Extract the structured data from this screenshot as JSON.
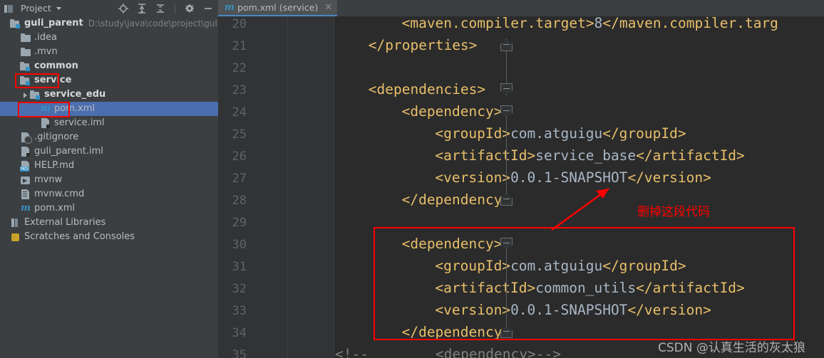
{
  "sidebar": {
    "header": {
      "title": "Project",
      "dropdown_icon": "chevron-down-icon",
      "toolbar": [
        {
          "name": "locate-icon",
          "tooltip": "Select Opened File"
        },
        {
          "name": "expand-all-icon",
          "tooltip": "Expand All"
        },
        {
          "name": "collapse-all-icon",
          "tooltip": "Collapse All"
        },
        {
          "name": "gear-icon",
          "tooltip": "Settings"
        },
        {
          "name": "minimize-icon",
          "tooltip": "Hide"
        }
      ]
    },
    "tree": [
      {
        "label": "guli_parent",
        "path": "D:\\study\\java\\code\\project\\guli_parent",
        "icon": "module-icon",
        "indent": 0,
        "bold": true,
        "arrow": "none",
        "selected": false
      },
      {
        "label": ".idea",
        "path": "",
        "icon": "folder-icon",
        "indent": 1,
        "bold": false,
        "arrow": "none",
        "selected": false
      },
      {
        "label": ".mvn",
        "path": "",
        "icon": "folder-icon",
        "indent": 1,
        "bold": false,
        "arrow": "none",
        "selected": false
      },
      {
        "label": "common",
        "path": "",
        "icon": "module-icon",
        "indent": 1,
        "bold": true,
        "arrow": "none",
        "selected": false
      },
      {
        "label": "service",
        "path": "",
        "icon": "module-icon",
        "indent": 1,
        "bold": true,
        "arrow": "none",
        "selected": false
      },
      {
        "label": "service_edu",
        "path": "",
        "icon": "module-icon",
        "indent": 2,
        "bold": true,
        "arrow": "closed",
        "selected": false
      },
      {
        "label": "pom.xml",
        "path": "",
        "icon": "maven-icon",
        "indent": 3,
        "bold": false,
        "arrow": "none",
        "selected": true
      },
      {
        "label": "service.iml",
        "path": "",
        "icon": "iml-file-icon",
        "indent": 3,
        "bold": false,
        "arrow": "none",
        "selected": false
      },
      {
        "label": ".gitignore",
        "path": "",
        "icon": "gitignore-file-icon",
        "indent": 1,
        "bold": false,
        "arrow": "none",
        "selected": false
      },
      {
        "label": "guli_parent.iml",
        "path": "",
        "icon": "iml-file-icon",
        "indent": 1,
        "bold": false,
        "arrow": "none",
        "selected": false
      },
      {
        "label": "HELP.md",
        "path": "",
        "icon": "markdown-file-icon",
        "indent": 1,
        "bold": false,
        "arrow": "none",
        "selected": false
      },
      {
        "label": "mvnw",
        "path": "",
        "icon": "shell-script-icon",
        "indent": 1,
        "bold": false,
        "arrow": "none",
        "selected": false
      },
      {
        "label": "mvnw.cmd",
        "path": "",
        "icon": "cmd-file-icon",
        "indent": 1,
        "bold": false,
        "arrow": "none",
        "selected": false
      },
      {
        "label": "pom.xml",
        "path": "",
        "icon": "maven-icon",
        "indent": 1,
        "bold": false,
        "arrow": "none",
        "selected": false
      },
      {
        "label": "External Libraries",
        "path": "",
        "icon": "libraries-icon",
        "indent": 0,
        "bold": false,
        "arrow": "none",
        "selected": false
      },
      {
        "label": "Scratches and Consoles",
        "path": "",
        "icon": "scratches-icon",
        "indent": 0,
        "bold": false,
        "arrow": "none",
        "selected": false
      }
    ]
  },
  "editor": {
    "tab": {
      "label": "pom.xml (service)",
      "icon": "maven-icon",
      "close_icon": "close-icon"
    },
    "lines": [
      {
        "num": "20",
        "indent": 8,
        "segments": [
          {
            "t": "tag",
            "s": "<maven.compiler.target>"
          },
          {
            "t": "val",
            "s": "8"
          },
          {
            "t": "tag",
            "s": "</maven.compiler.targ"
          }
        ]
      },
      {
        "num": "21",
        "indent": 4,
        "segments": [
          {
            "t": "tag",
            "s": "</properties>"
          }
        ]
      },
      {
        "num": "22",
        "indent": 0,
        "segments": []
      },
      {
        "num": "23",
        "indent": 4,
        "segments": [
          {
            "t": "tag",
            "s": "<dependencies>"
          }
        ]
      },
      {
        "num": "24",
        "indent": 8,
        "segments": [
          {
            "t": "tag",
            "s": "<dependency>"
          }
        ]
      },
      {
        "num": "25",
        "indent": 12,
        "segments": [
          {
            "t": "tag",
            "s": "<groupId>"
          },
          {
            "t": "val",
            "s": "com.atguigu"
          },
          {
            "t": "tag",
            "s": "</groupId>"
          }
        ]
      },
      {
        "num": "26",
        "indent": 12,
        "segments": [
          {
            "t": "tag",
            "s": "<artifactId>"
          },
          {
            "t": "val",
            "s": "service_base"
          },
          {
            "t": "tag",
            "s": "</artifactId>"
          }
        ]
      },
      {
        "num": "27",
        "indent": 12,
        "segments": [
          {
            "t": "tag",
            "s": "<version>"
          },
          {
            "t": "val",
            "s": "0.0.1-SNAPSHOT"
          },
          {
            "t": "tag",
            "s": "</version>"
          }
        ]
      },
      {
        "num": "28",
        "indent": 8,
        "segments": [
          {
            "t": "tag",
            "s": "</dependency>"
          }
        ]
      },
      {
        "num": "29",
        "indent": 0,
        "segments": []
      },
      {
        "num": "30",
        "indent": 8,
        "segments": [
          {
            "t": "tag",
            "s": "<dependency>"
          }
        ]
      },
      {
        "num": "31",
        "indent": 12,
        "segments": [
          {
            "t": "tag",
            "s": "<groupId>"
          },
          {
            "t": "val",
            "s": "com.atguigu"
          },
          {
            "t": "tag",
            "s": "</groupId>"
          }
        ]
      },
      {
        "num": "32",
        "indent": 12,
        "segments": [
          {
            "t": "tag",
            "s": "<artifactId>"
          },
          {
            "t": "val",
            "s": "common_utils"
          },
          {
            "t": "tag",
            "s": "</artifactId>"
          }
        ]
      },
      {
        "num": "33",
        "indent": 12,
        "segments": [
          {
            "t": "tag",
            "s": "<version>"
          },
          {
            "t": "val",
            "s": "0.0.1-SNAPSHOT"
          },
          {
            "t": "tag",
            "s": "</version>"
          }
        ]
      },
      {
        "num": "34",
        "indent": 8,
        "segments": [
          {
            "t": "tag",
            "s": "</dependency>"
          }
        ]
      },
      {
        "num": "35",
        "indent": 0,
        "segments": [
          {
            "t": "cmt",
            "s": "<!--        <dependency>-->"
          }
        ]
      }
    ],
    "fold_markers": [
      {
        "line": "21",
        "type": "end"
      },
      {
        "line": "23",
        "type": "start"
      },
      {
        "line": "24",
        "type": "start"
      },
      {
        "line": "28",
        "type": "end"
      },
      {
        "line": "30",
        "type": "start"
      },
      {
        "line": "34",
        "type": "end"
      }
    ]
  },
  "annotations": {
    "note_text": "删掉这段代码",
    "note_color": "#ff0000",
    "box_color": "#ff0000",
    "arrow_icon": "arrow-up-right-icon"
  },
  "watermark": {
    "text": "CSDN @认真生活的灰太狼"
  },
  "colors": {
    "sidebar_bg": "#3c3f41",
    "editor_bg": "#2b2b2b",
    "gutter_bg": "#313335",
    "selection_blue": "#4b6eaf",
    "tag_orange": "#e8bf6a",
    "value_grey": "#a9b7c6",
    "comment_grey": "#808080",
    "annotation_red": "#ff0000"
  }
}
